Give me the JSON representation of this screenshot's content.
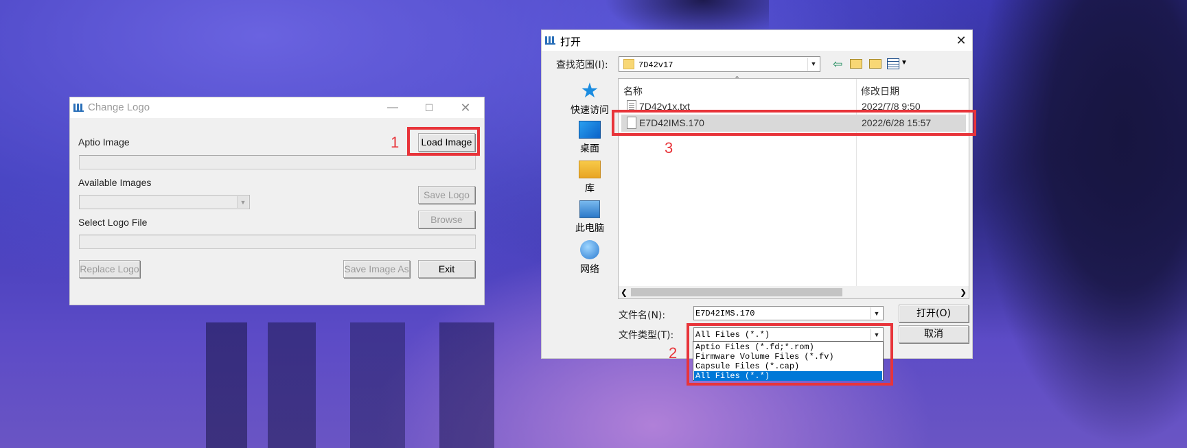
{
  "change_logo": {
    "title": "Change Logo",
    "aptio_label": "Aptio Image",
    "load_image": "Load Image",
    "available_label": "Available Images",
    "save_logo": "Save Logo",
    "select_logo_label": "Select Logo File",
    "browse": "Browse",
    "replace_logo": "Replace Logo",
    "save_image_as": "Save Image As",
    "exit": "Exit"
  },
  "annotations": {
    "step1": "1",
    "step2": "2",
    "step3": "3"
  },
  "open_dialog": {
    "title": "打开",
    "lookin_label": "查找范围(I):",
    "lookin_value": "7D42v17",
    "places": [
      "快速访问",
      "桌面",
      "库",
      "此电脑",
      "网络"
    ],
    "col_name": "名称",
    "col_date": "修改日期",
    "files": [
      {
        "name": "7D42v1x.txt",
        "date": "2022/7/8 9:50"
      },
      {
        "name": "E7D42IMS.170",
        "date": "2022/6/28 15:57"
      }
    ],
    "filename_label": "文件名(N):",
    "filename_value": "E7D42IMS.170",
    "filetype_label": "文件类型(T):",
    "filetype_value": "All Files (*.*)",
    "filetype_options": [
      "Aptio Files (*.fd;*.rom)",
      "Firmware Volume Files (*.fv)",
      "Capsule Files (*.cap)",
      "All Files (*.*)"
    ],
    "open_btn": "打开(O)",
    "cancel_btn": "取消"
  },
  "colors": {
    "highlight": "#e8343a",
    "selection": "#0078d7"
  }
}
